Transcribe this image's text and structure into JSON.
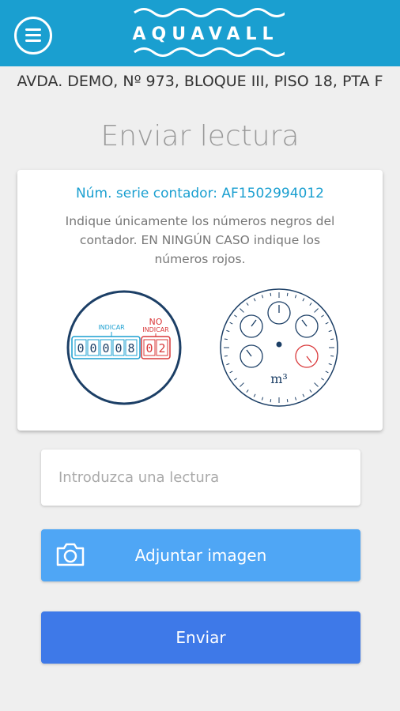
{
  "header": {
    "logo_text": "AQUAVALL",
    "menu_icon": "hamburger-menu-icon",
    "background_color": "#1a9fd0"
  },
  "address": "AVDA. DEMO, Nº 973, BLOQUE III, PISO 18, PTA F",
  "title": "Enviar lectura",
  "card": {
    "serial": "Núm. serie contador: AF1502994012",
    "instructions": "Indique únicamente los números negros del contador. EN NINGÚN CASO indique los números rojos.",
    "digital_meter": {
      "indicate_label": "INDICAR",
      "no_indicate_label_1": "NO",
      "no_indicate_label_2": "INDICAR",
      "black_digits": [
        "0",
        "0",
        "0",
        "0",
        "8"
      ],
      "red_digits": [
        "0",
        "2"
      ]
    },
    "analog_meter": {
      "unit_label": "m³"
    }
  },
  "reading_input": {
    "placeholder": "Introduzca una lectura",
    "value": ""
  },
  "attach_button": {
    "label": "Adjuntar imagen",
    "icon": "camera-icon",
    "color": "#4fa6f5"
  },
  "send_button": {
    "label": "Enviar",
    "color": "#3e79e8"
  }
}
